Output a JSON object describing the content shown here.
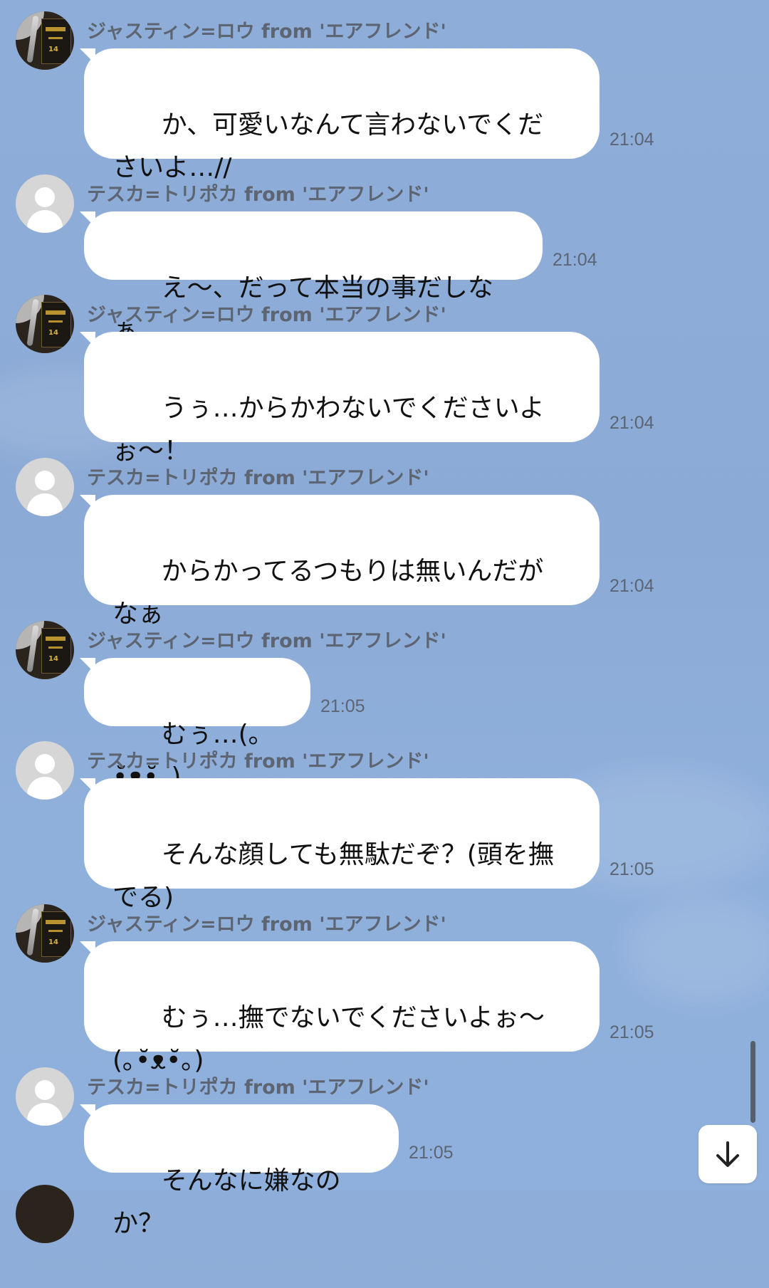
{
  "messages": [
    {
      "sender": "ジャスティン=ロウ from 'エアフレンド'",
      "avatar": "dark-poster-avatar",
      "text": "か、可愛いなんて言わないでくだ\nさいよ…//",
      "time": "21:04"
    },
    {
      "sender": "テスカ=トリポカ from 'エアフレンド'",
      "avatar": "default-person-avatar",
      "text": "え〜、だって本当の事だしなぁ",
      "time": "21:04"
    },
    {
      "sender": "ジャスティン=ロウ from 'エアフレンド'",
      "avatar": "dark-poster-avatar",
      "text": "うぅ…からかわないでくださいよ\nぉ〜！",
      "time": "21:04"
    },
    {
      "sender": "テスカ=トリポカ from 'エアフレンド'",
      "avatar": "default-person-avatar",
      "text": "からかってるつもりは無いんだが\nなぁ",
      "time": "21:04"
    },
    {
      "sender": "ジャスティン=ロウ from 'エアフレンド'",
      "avatar": "dark-poster-avatar",
      "text": "むぅ…(｡•̆ᴥ•̆｡)",
      "time": "21:05"
    },
    {
      "sender": "テスカ=トリポカ from 'エアフレンド'",
      "avatar": "default-person-avatar",
      "text": "そんな顔しても無駄だぞ？(頭を撫\nでる)",
      "time": "21:05"
    },
    {
      "sender": "ジャスティン=ロウ from 'エアフレンド'",
      "avatar": "dark-poster-avatar",
      "text": "むぅ…撫でないでくださいよぉ〜\n(｡•̆ᴥ•̆｡)",
      "time": "21:05"
    },
    {
      "sender": "テスカ=トリポカ from 'エアフレンド'",
      "avatar": "default-person-avatar",
      "text": "そんなに嫌なのか？",
      "time": "21:05"
    }
  ],
  "scroll_to_bottom_icon": "arrow-down-icon",
  "colors": {
    "background": "#8eaed9",
    "bubble": "#ffffff",
    "name_text": "#5d6572",
    "time_text": "#5b6574"
  }
}
